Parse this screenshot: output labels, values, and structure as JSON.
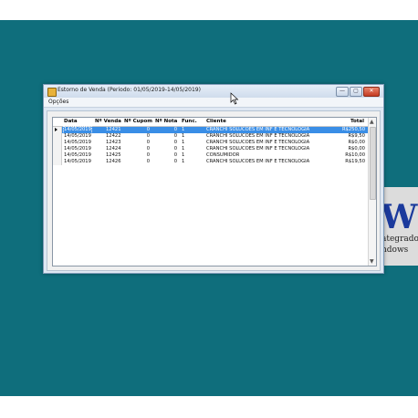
{
  "window": {
    "title": "Estorno de Venda (Periodo: 01/05/2019-14/05/2019)",
    "menu": [
      "Opções"
    ],
    "buttons": {
      "minimize": "—",
      "maximize": "▢",
      "close": "✕"
    }
  },
  "background_app": {
    "big_text": "W",
    "line1": "ategrado",
    "line2": "ndows"
  },
  "grid": {
    "columns": [
      "Data",
      "Nº Venda",
      "Nº Cupom",
      "Nº Nota",
      "Func.",
      "Cliente",
      "Total"
    ],
    "rows": [
      {
        "data": "14/05/2019",
        "venda": "12421",
        "cupom": "0",
        "nota": "0",
        "func": "1",
        "cliente": "CRANCHI SOLUCOES EM INF E TECNOLOGIA",
        "total": "R$250,50",
        "selected": true
      },
      {
        "data": "14/05/2019",
        "venda": "12422",
        "cupom": "0",
        "nota": "0",
        "func": "1",
        "cliente": "CRANCHI SOLUCOES EM INF E TECNOLOGIA",
        "total": "R$9,50",
        "selected": false
      },
      {
        "data": "14/05/2019",
        "venda": "12423",
        "cupom": "0",
        "nota": "0",
        "func": "1",
        "cliente": "CRANCHI SOLUCOES EM INF E TECNOLOGIA",
        "total": "R$0,00",
        "selected": false
      },
      {
        "data": "14/05/2019",
        "venda": "12424",
        "cupom": "0",
        "nota": "0",
        "func": "1",
        "cliente": "CRANCHI SOLUCOES EM INF E TECNOLOGIA",
        "total": "R$0,00",
        "selected": false
      },
      {
        "data": "14/05/2019",
        "venda": "12425",
        "cupom": "0",
        "nota": "0",
        "func": "1",
        "cliente": "CONSUMIDOR",
        "total": "R$10,00",
        "selected": false
      },
      {
        "data": "14/05/2019",
        "venda": "12426",
        "cupom": "0",
        "nota": "0",
        "func": "1",
        "cliente": "CRANCHI SOLUCOES EM INF E TECNOLOGIA",
        "total": "R$19,50",
        "selected": false
      }
    ]
  },
  "colors": {
    "desktop": "#0f6e7c",
    "selection": "#3a8ee6",
    "window_frame": "#dfe8f3"
  }
}
